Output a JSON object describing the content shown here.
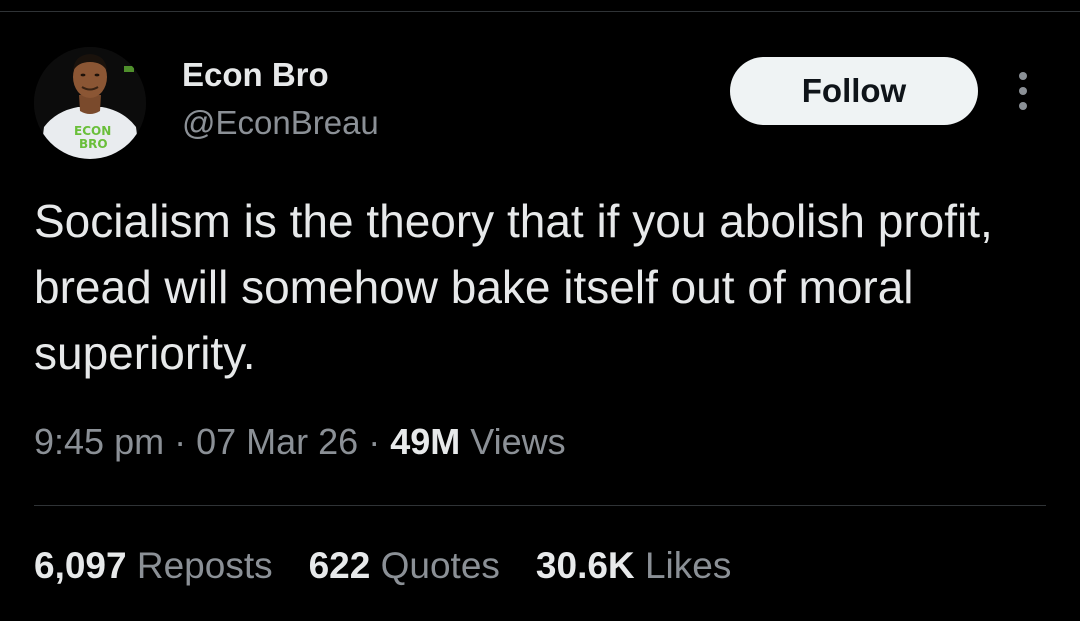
{
  "author": {
    "display_name": "Econ Bro",
    "handle": "@EconBreau",
    "avatar_shirt_text_line1": "ECON",
    "avatar_shirt_text_line2": "BRO"
  },
  "actions": {
    "follow_label": "Follow",
    "more_icon": "more-vertical-icon"
  },
  "tweet": {
    "text": "Socialism is the theory that if you abolish profit, bread will somehow bake itself out of moral superiority."
  },
  "meta": {
    "time": "9:45 pm",
    "separator": "·",
    "date": "07 Mar 26",
    "views_count": "49M",
    "views_label": "Views"
  },
  "stats": {
    "reposts_count": "6,097",
    "reposts_label": "Reposts",
    "quotes_count": "622",
    "quotes_label": "Quotes",
    "likes_count": "30.6K",
    "likes_label": "Likes"
  },
  "colors": {
    "background": "#000000",
    "primary_text": "#e7e9ea",
    "secondary_text": "#8b9096",
    "follow_button_bg": "#eff3f4",
    "divider": "#2f3336",
    "avatar_logo_green": "#6abf3a"
  }
}
